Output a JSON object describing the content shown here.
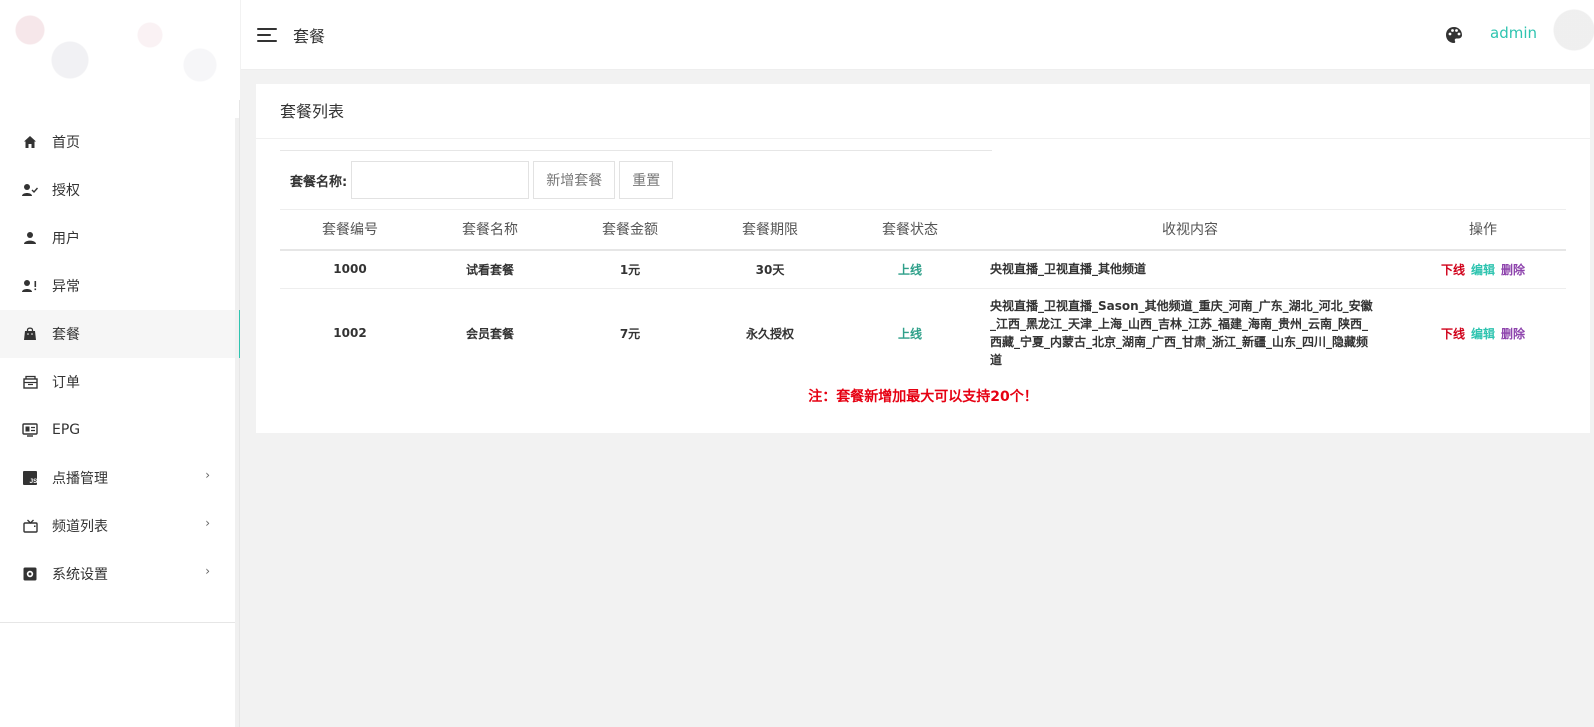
{
  "header": {
    "title": "套餐",
    "user": "admin",
    "palette_icon": "palette-icon",
    "menu_icon": "hamburger-menu-icon"
  },
  "sidebar": {
    "items": [
      {
        "label": "首页",
        "icon": "home-icon"
      },
      {
        "label": "授权",
        "icon": "user-check-icon"
      },
      {
        "label": "用户",
        "icon": "user-icon"
      },
      {
        "label": "异常",
        "icon": "user-alert-icon"
      },
      {
        "label": "套餐",
        "icon": "shopping-bag-icon",
        "active": true
      },
      {
        "label": "订单",
        "icon": "order-icon"
      },
      {
        "label": "EPG",
        "icon": "epg-icon"
      },
      {
        "label": "点播管理",
        "icon": "js-icon",
        "arrow": "›"
      },
      {
        "label": "频道列表",
        "icon": "tv-icon",
        "arrow": "›"
      },
      {
        "label": "系统设置",
        "icon": "settings-icon",
        "arrow": "›"
      }
    ]
  },
  "main": {
    "card_title": "套餐列表",
    "search": {
      "label": "套餐名称:",
      "value": "",
      "placeholder": ""
    },
    "buttons": {
      "add": "新增套餐",
      "reset": "重置"
    },
    "table": {
      "columns": [
        "套餐编号",
        "套餐名称",
        "套餐金额",
        "套餐期限",
        "套餐状态",
        "收视内容",
        "操作"
      ],
      "rows": [
        {
          "id": "1000",
          "name": "试看套餐",
          "amount": "1元",
          "period": "30天",
          "status": "上线",
          "content": "央视直播_卫视直播_其他频道",
          "ops": {
            "down": "下线",
            "edit": "编辑",
            "delete": "删除"
          }
        },
        {
          "id": "1002",
          "name": "会员套餐",
          "amount": "7元",
          "period": "永久授权",
          "status": "上线",
          "content": "央视直播_卫视直播_Sason_其他频道_重庆_河南_广东_湖北_河北_安徽_江西_黑龙江_天津_上海_山西_吉林_江苏_福建_海南_贵州_云南_陕西_西藏_宁夏_内蒙古_北京_湖南_广西_甘肃_浙江_新疆_山东_四川_隐藏频道",
          "ops": {
            "down": "下线",
            "edit": "编辑",
            "delete": "删除"
          }
        }
      ]
    },
    "note": "注：套餐新增加最大可以支持20个！"
  },
  "colors": {
    "accent": "#2fc4b0",
    "danger": "#d0021b",
    "note": "#e60012",
    "delete": "#8e44ad",
    "status_online": "#2fa08a"
  }
}
